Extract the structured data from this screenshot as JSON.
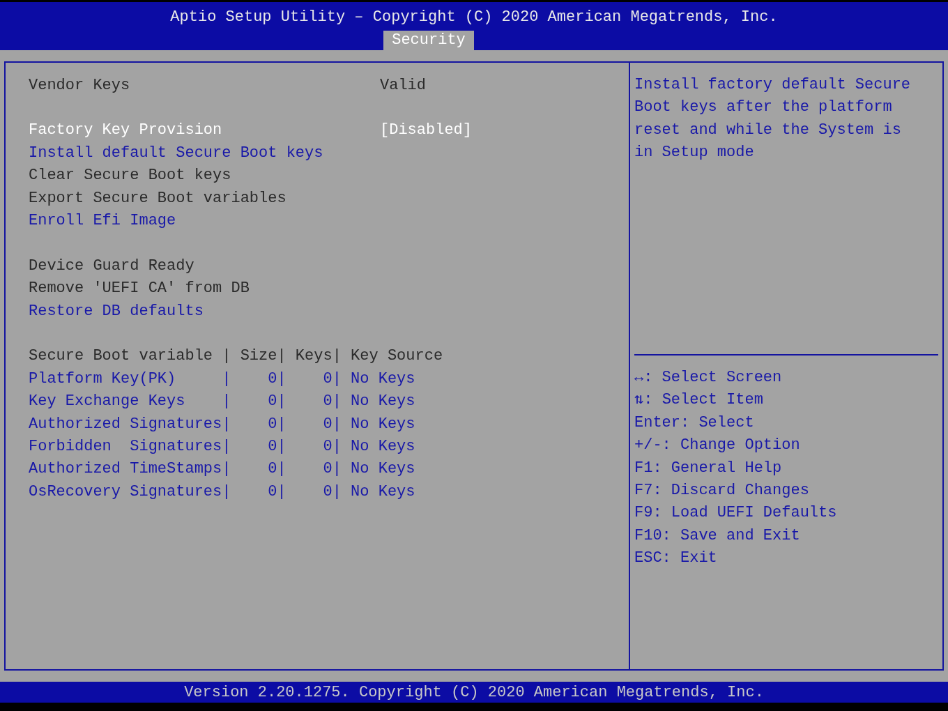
{
  "header": {
    "title": "Aptio Setup Utility – Copyright (C) 2020 American Megatrends, Inc.",
    "tabs": [
      {
        "label": "Security",
        "selected": true
      }
    ]
  },
  "sections": [
    {
      "items": [
        {
          "kind": "info",
          "label": "Vendor Keys",
          "value": "Valid",
          "selected": false
        }
      ]
    },
    {
      "items": [
        {
          "kind": "option",
          "label": "Factory Key Provision",
          "value": "[Disabled]",
          "selected": true
        },
        {
          "kind": "option",
          "label": "Install default Secure Boot keys",
          "selected": false
        },
        {
          "kind": "info",
          "label": "Clear Secure Boot keys",
          "selected": false
        },
        {
          "kind": "info",
          "label": "Export Secure Boot variables",
          "selected": false
        },
        {
          "kind": "option",
          "label": "Enroll Efi Image",
          "selected": false
        }
      ]
    },
    {
      "items": [
        {
          "kind": "info",
          "label": "Device Guard Ready",
          "selected": false
        },
        {
          "kind": "info",
          "label": "Remove 'UEFI CA' from DB",
          "selected": false
        },
        {
          "kind": "option",
          "label": "Restore DB defaults",
          "selected": false
        }
      ]
    },
    {
      "items": [
        {
          "kind": "info",
          "label": "Secure Boot variable | Size| Keys| Key Source",
          "selected": false
        },
        {
          "kind": "option",
          "label": "Platform Key(PK)     |    0|    0| No Keys",
          "selected": false
        },
        {
          "kind": "option",
          "label": "Key Exchange Keys    |    0|    0| No Keys",
          "selected": false
        },
        {
          "kind": "option",
          "label": "Authorized Signatures|    0|    0| No Keys",
          "selected": false
        },
        {
          "kind": "option",
          "label": "Forbidden  Signatures|    0|    0| No Keys",
          "selected": false
        },
        {
          "kind": "option",
          "label": "Authorized TimeStamps|    0|    0| No Keys",
          "selected": false
        },
        {
          "kind": "option",
          "label": "OsRecovery Signatures|    0|    0| No Keys",
          "selected": false
        }
      ]
    }
  ],
  "help": "Install factory default Secure Boot keys after the platform reset and while the System is in Setup mode",
  "key_legend": [
    "↔: Select Screen",
    "⇅: Select Item",
    "Enter: Select",
    "+/-: Change Option",
    "F1: General Help",
    "F7: Discard Changes",
    "F9: Load UEFI Defaults",
    "F10: Save and Exit",
    "ESC: Exit"
  ],
  "footer": "Version 2.20.1275. Copyright (C) 2020 American Megatrends, Inc."
}
